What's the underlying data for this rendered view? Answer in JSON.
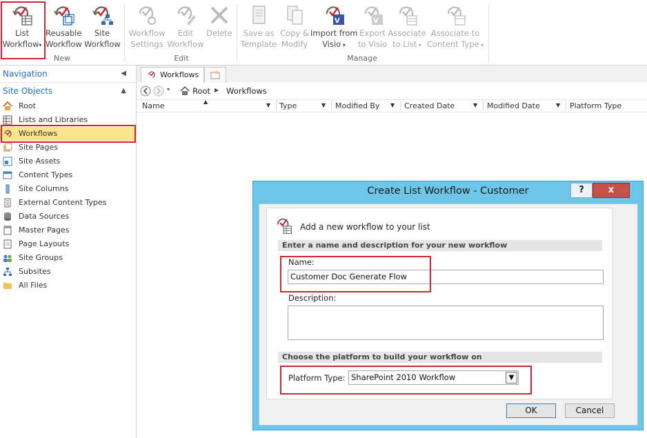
{
  "ribbon": {
    "groups": {
      "new": "New",
      "edit": "Edit",
      "manage": "Manage"
    },
    "buttons": {
      "list_workflow": [
        "List",
        "Workflow"
      ],
      "reusable_workflow": [
        "Reusable",
        "Workflow"
      ],
      "site_workflow": [
        "Site",
        "Workflow"
      ],
      "workflow_settings": [
        "Workflow",
        "Settings"
      ],
      "edit_workflow": [
        "Edit",
        "Workflow"
      ],
      "delete": [
        "Delete"
      ],
      "save_as_template": [
        "Save as",
        "Template"
      ],
      "copy_modify": [
        "Copy &",
        "Modify"
      ],
      "import_from_visio": [
        "Import from",
        "Visio"
      ],
      "export_to_visio": [
        "Export",
        "to Visio"
      ],
      "associate_to_list": [
        "Associate",
        "to List"
      ],
      "associate_to_content_type": [
        "Associate to",
        "Content Type"
      ]
    }
  },
  "nav": {
    "title": "Navigation",
    "section": "Site Objects",
    "items": [
      {
        "label": "Root",
        "icon": "home-icon"
      },
      {
        "label": "Lists and Libraries",
        "icon": "list-icon"
      },
      {
        "label": "Workflows",
        "icon": "workflow-icon",
        "selected": true
      },
      {
        "label": "Site Pages",
        "icon": "pages-icon"
      },
      {
        "label": "Site Assets",
        "icon": "assets-icon"
      },
      {
        "label": "Content Types",
        "icon": "content-types-icon"
      },
      {
        "label": "Site Columns",
        "icon": "columns-icon"
      },
      {
        "label": "External Content Types",
        "icon": "external-content-icon"
      },
      {
        "label": "Data Sources",
        "icon": "database-icon"
      },
      {
        "label": "Master Pages",
        "icon": "master-page-icon"
      },
      {
        "label": "Page Layouts",
        "icon": "page-layout-icon"
      },
      {
        "label": "Site Groups",
        "icon": "groups-icon"
      },
      {
        "label": "Subsites",
        "icon": "subsites-icon"
      },
      {
        "label": "All Files",
        "icon": "folder-icon"
      }
    ]
  },
  "tab": {
    "label": "Workflows"
  },
  "breadcrumb": {
    "root": "Root",
    "current": "Workflows"
  },
  "columns": [
    "Name",
    "Type",
    "Modified By",
    "Created Date",
    "Modified Date",
    "Platform Type"
  ],
  "dialog": {
    "title": "Create List Workflow - Customer",
    "help_btn": "?",
    "close_btn": "x",
    "heading": "Add a new workflow to your list",
    "section1": "Enter a name and description for your new workflow",
    "name_label": "Name:",
    "name_value": "Customer Doc Generate Flow",
    "description_label": "Description:",
    "description_value": "",
    "section2": "Choose the platform to build your workflow on",
    "platform_label": "Platform Type:",
    "platform_value": "SharePoint 2010 Workflow",
    "ok": "OK",
    "cancel": "Cancel"
  },
  "colors": {
    "accent_red": "#d3232f",
    "selected_bg": "#fce48b",
    "dialog_frame": "#6dc6e7",
    "nav_blue": "#2a6ebb"
  }
}
